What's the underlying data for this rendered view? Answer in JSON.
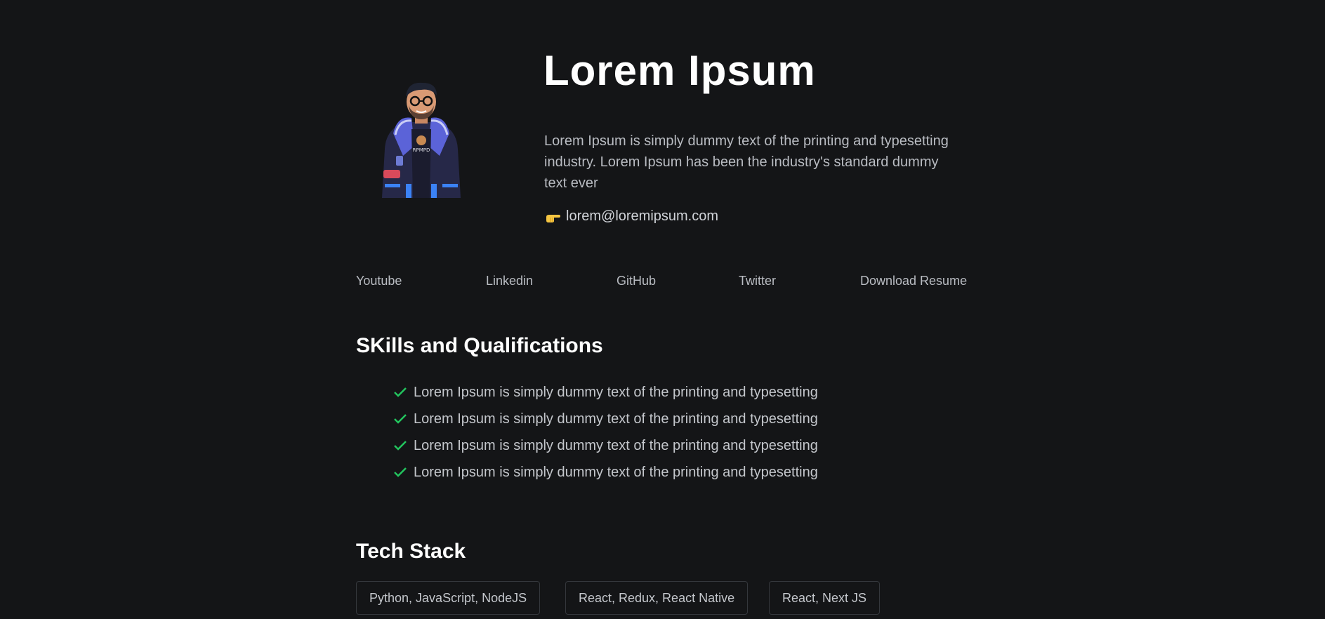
{
  "hero": {
    "title": "Lorem Ipsum",
    "description": "Lorem Ipsum is simply dummy text of the printing and typesetting industry. Lorem Ipsum has been the industry's standard dummy text ever",
    "email": "lorem@loremipsum.com",
    "email_icon": "pointing-hand-icon",
    "avatar_badge": "RPMPD"
  },
  "links": [
    {
      "label": "Youtube"
    },
    {
      "label": "Linkedin"
    },
    {
      "label": "GitHub"
    },
    {
      "label": "Twitter"
    },
    {
      "label": "Download Resume"
    }
  ],
  "skills": {
    "title": "SKills and Qualifications",
    "icon": "check-icon",
    "items": [
      "Lorem Ipsum is simply dummy text of the printing and typesetting",
      "Lorem Ipsum is simply dummy text of the printing and typesetting",
      "Lorem Ipsum is simply dummy text of the printing and typesetting",
      "Lorem Ipsum is simply dummy text of the printing and typesetting"
    ]
  },
  "tech_stack": {
    "title": "Tech Stack",
    "items": [
      "Python, JavaScript, NodeJS",
      "React, Redux, React Native",
      "React, Next JS"
    ]
  },
  "colors": {
    "background": "#141517",
    "heading": "#ffffff",
    "body_text": "#b9bcc2",
    "check": "#22c55e",
    "chip_border": "#34373c"
  }
}
